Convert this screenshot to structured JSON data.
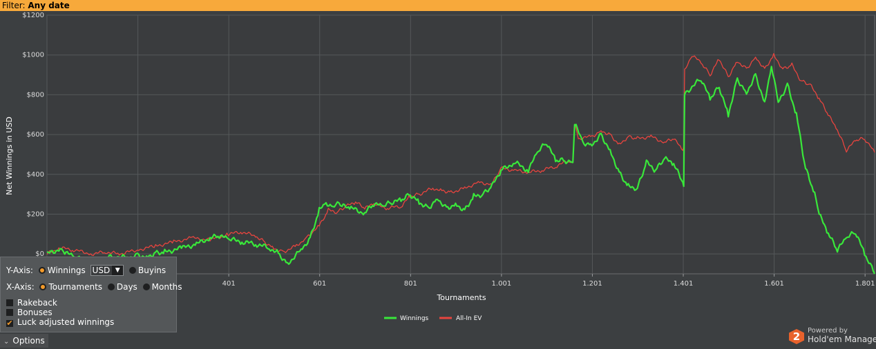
{
  "filter": {
    "label": "Filter:",
    "value": "Any date"
  },
  "colors": {
    "background": "#3c3f41",
    "filter_bar": "#f7a93b",
    "winnings": "#39e83a",
    "allin_ev": "#e8443e"
  },
  "chart_data": {
    "type": "line",
    "xlabel": "Tournaments",
    "ylabel": "Net Winnings in USD",
    "xlim": [
      1,
      1822
    ],
    "ylim": [
      -100,
      1200
    ],
    "x_ticks": [
      "401",
      "601",
      "801",
      "1.001",
      "1.201",
      "1.401",
      "1.601",
      "1.801"
    ],
    "x_tick_values": [
      401,
      601,
      801,
      1001,
      1201,
      1401,
      1601,
      1801
    ],
    "y_ticks": [
      "$0",
      "$200",
      "$400",
      "$600",
      "$800",
      "$1000",
      "$1200"
    ],
    "y_tick_values": [
      0,
      200,
      400,
      600,
      800,
      1000,
      1200
    ],
    "grid": true,
    "legend_position": "bottom-center",
    "series": [
      {
        "name": "Winnings",
        "color": "#39e83a",
        "x": [
          1,
          30,
          40,
          60,
          90,
          120,
          150,
          180,
          200,
          220,
          240,
          260,
          300,
          330,
          360,
          380,
          400,
          430,
          460,
          490,
          510,
          530,
          560,
          580,
          600,
          615,
          630,
          640,
          650,
          670,
          700,
          720,
          740,
          760,
          780,
          800,
          820,
          840,
          860,
          880,
          900,
          920,
          940,
          960,
          980,
          1000,
          1030,
          1060,
          1080,
          1100,
          1120,
          1140,
          1158,
          1162,
          1165,
          1180,
          1200,
          1220,
          1240,
          1260,
          1280,
          1300,
          1320,
          1340,
          1360,
          1380,
          1400,
          1402,
          1404,
          1420,
          1440,
          1460,
          1480,
          1500,
          1520,
          1540,
          1560,
          1580,
          1595,
          1610,
          1630,
          1650,
          1670,
          1690,
          1700,
          1720,
          1740,
          1760,
          1780,
          1800,
          1822
        ],
        "y": [
          0,
          25,
          10,
          -15,
          -40,
          -30,
          -10,
          -20,
          -5,
          -15,
          5,
          10,
          30,
          50,
          80,
          90,
          75,
          60,
          50,
          30,
          5,
          -50,
          20,
          80,
          220,
          260,
          230,
          250,
          240,
          230,
          205,
          250,
          240,
          260,
          270,
          300,
          260,
          230,
          280,
          230,
          250,
          220,
          290,
          300,
          340,
          420,
          460,
          420,
          510,
          560,
          470,
          470,
          460,
          650,
          640,
          560,
          550,
          600,
          520,
          410,
          340,
          330,
          460,
          420,
          480,
          450,
          360,
          340,
          800,
          840,
          880,
          780,
          840,
          700,
          880,
          810,
          900,
          760,
          950,
          760,
          850,
          700,
          430,
          300,
          200,
          100,
          20,
          80,
          110,
          0,
          -100
        ],
        "label_points": []
      },
      {
        "name": "All-In EV",
        "color": "#e8443e",
        "x": [
          1,
          30,
          60,
          100,
          130,
          160,
          200,
          240,
          280,
          320,
          360,
          400,
          430,
          460,
          480,
          500,
          520,
          550,
          570,
          600,
          620,
          640,
          660,
          680,
          700,
          720,
          750,
          780,
          800,
          820,
          850,
          870,
          890,
          920,
          950,
          980,
          1000,
          1030,
          1060,
          1090,
          1120,
          1150,
          1158,
          1162,
          1170,
          1200,
          1220,
          1240,
          1260,
          1280,
          1300,
          1330,
          1360,
          1380,
          1400,
          1402,
          1404,
          1420,
          1440,
          1460,
          1480,
          1500,
          1520,
          1540,
          1560,
          1580,
          1600,
          1620,
          1640,
          1660,
          1680,
          1700,
          1720,
          1740,
          1760,
          1780,
          1800,
          1822
        ],
        "y": [
          0,
          30,
          20,
          0,
          10,
          0,
          20,
          40,
          60,
          80,
          70,
          100,
          110,
          90,
          60,
          30,
          10,
          40,
          80,
          140,
          220,
          210,
          240,
          260,
          230,
          250,
          230,
          240,
          290,
          300,
          330,
          320,
          310,
          330,
          360,
          350,
          430,
          420,
          410,
          420,
          440,
          470,
          460,
          660,
          580,
          590,
          620,
          600,
          550,
          590,
          580,
          590,
          560,
          580,
          520,
          540,
          920,
          1000,
          960,
          900,
          980,
          890,
          970,
          930,
          990,
          930,
          1000,
          930,
          950,
          870,
          850,
          780,
          700,
          620,
          520,
          570,
          580,
          510
        ]
      }
    ]
  }
}
